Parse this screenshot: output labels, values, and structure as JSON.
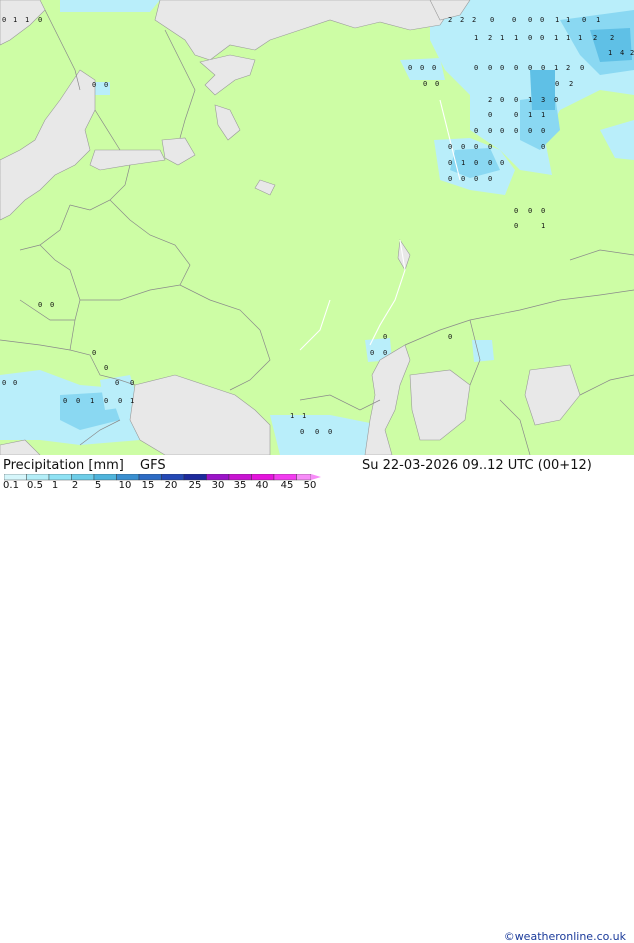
{
  "title": "Precipitation [mm]",
  "model": "GFS",
  "valid_time": "Su 22-03-2026 09..12 UTC (00+12)",
  "credit": "©weatheronline.co.uk",
  "legend": {
    "ticks": [
      "0.1",
      "0.5",
      "1",
      "2",
      "5",
      "10",
      "15",
      "20",
      "25",
      "30",
      "35",
      "40",
      "45",
      "50"
    ],
    "colors": [
      "#d6f6fb",
      "#b4eef8",
      "#8fe2f4",
      "#6ecde8",
      "#4fb4dc",
      "#3a8fd0",
      "#2d6bc4",
      "#2449b5",
      "#1d2a9c",
      "#9b14c8",
      "#c814d2",
      "#e414dc",
      "#f23cf0",
      "#f78cf8"
    ]
  },
  "map": {
    "land_color": "#cdfda5",
    "water_color": "#e8e8e8",
    "precip_light": "#b9eefa",
    "precip_mid": "#8ad8f2",
    "precip_heavy": "#5fc0e6",
    "precip_labels": [
      "0",
      "1",
      "1",
      "0",
      "2",
      "2",
      "2",
      "0",
      "0",
      "0",
      "0",
      "1",
      "1",
      "0",
      "1",
      "1",
      "2",
      "1",
      "1",
      "0",
      "0",
      "1",
      "1",
      "1",
      "2",
      "2",
      "0",
      "0",
      "0",
      "0",
      "0",
      "0",
      "0",
      "0",
      "0",
      "1",
      "2",
      "0",
      "1",
      "4",
      "2",
      "0",
      "0",
      "0",
      "0",
      "0",
      "2",
      "2",
      "0",
      "0",
      "1",
      "3",
      "0",
      "0",
      "0",
      "1",
      "1",
      "0",
      "0",
      "0",
      "0",
      "0",
      "0",
      "0",
      "0",
      "0",
      "0",
      "0",
      "0",
      "1",
      "0",
      "0",
      "0",
      "0",
      "0",
      "0",
      "0",
      "0",
      "0",
      "0",
      "0",
      "1",
      "0",
      "0",
      "0",
      "0",
      "0",
      "0",
      "0",
      "0",
      "0",
      "0",
      "0",
      "0",
      "0",
      "0",
      "1",
      "0",
      "0",
      "1",
      "1",
      "1",
      "0",
      "0",
      "0"
    ]
  }
}
